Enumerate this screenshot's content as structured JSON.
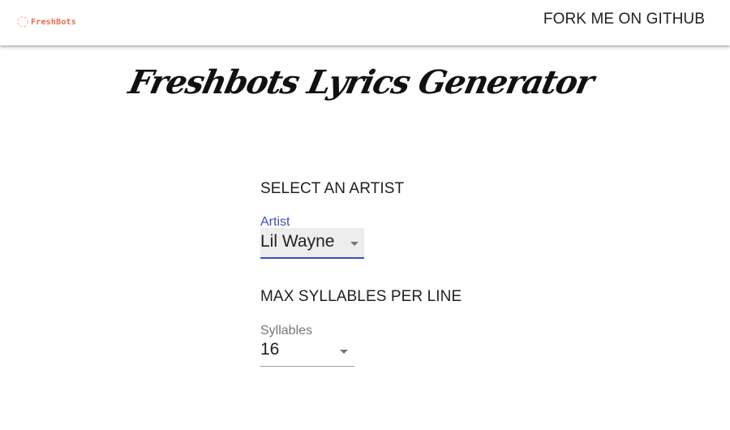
{
  "header": {
    "logo_text": "FreshBots",
    "github_link": "FORK ME ON GITHUB"
  },
  "main": {
    "title": "Freshbots Lyrics Generator",
    "artist_section": {
      "heading": "SELECT AN ARTIST",
      "field_label": "Artist",
      "selected_value": "Lil Wayne",
      "focused": true
    },
    "syllables_section": {
      "heading": "MAX SYLLABLES PER LINE",
      "field_label": "Syllables",
      "selected_value": "16"
    }
  },
  "colors": {
    "accent": "#3f51b5",
    "logo": "#e8684a",
    "text": "#212121",
    "muted": "#757575"
  }
}
